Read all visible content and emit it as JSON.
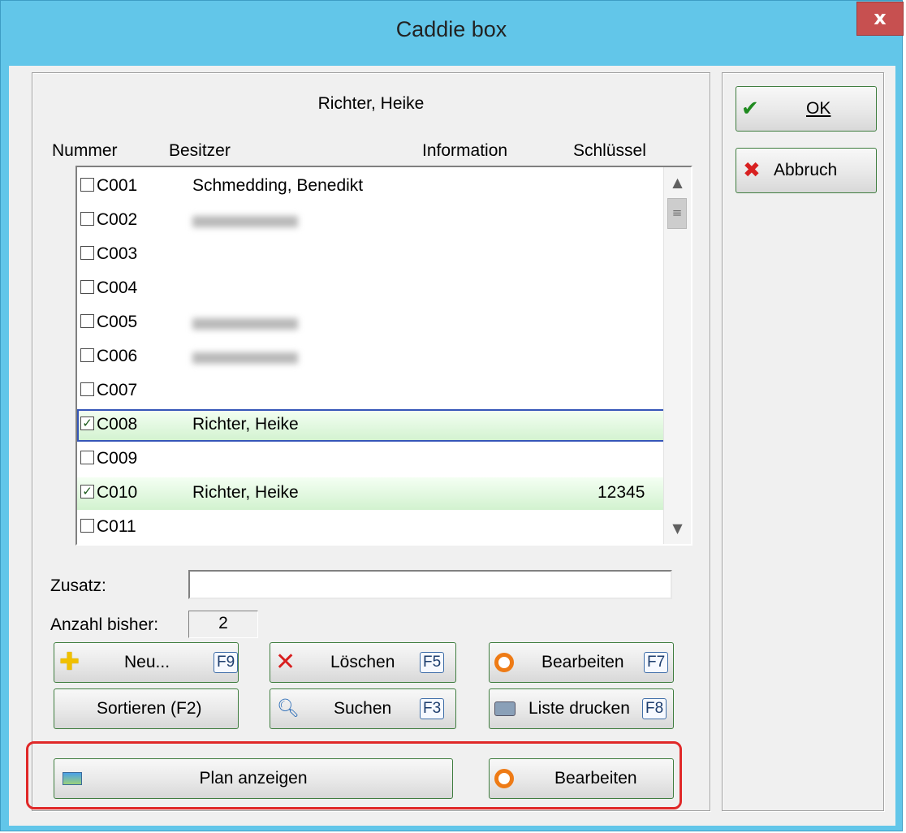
{
  "window": {
    "title": "Caddie box",
    "close_glyph": "x"
  },
  "person_header": "Richter, Heike",
  "columns": {
    "number": "Nummer",
    "owner": "Besitzer",
    "information": "Information",
    "key": "Schlüssel"
  },
  "rows": [
    {
      "checked": false,
      "number": "C001",
      "owner": "Schmedding, Benedikt",
      "owner_blurred": false,
      "info": "",
      "key": ""
    },
    {
      "checked": false,
      "number": "C002",
      "owner": "",
      "owner_blurred": true,
      "info": "",
      "key": ""
    },
    {
      "checked": false,
      "number": "C003",
      "owner": "",
      "owner_blurred": false,
      "info": "",
      "key": ""
    },
    {
      "checked": false,
      "number": "C004",
      "owner": "",
      "owner_blurred": false,
      "info": "",
      "key": ""
    },
    {
      "checked": false,
      "number": "C005",
      "owner": "",
      "owner_blurred": true,
      "info": "",
      "key": ""
    },
    {
      "checked": false,
      "number": "C006",
      "owner": "",
      "owner_blurred": true,
      "info": "",
      "key": ""
    },
    {
      "checked": false,
      "number": "C007",
      "owner": "",
      "owner_blurred": false,
      "info": "",
      "key": ""
    },
    {
      "checked": true,
      "number": "C008",
      "owner": "Richter, Heike",
      "owner_blurred": false,
      "info": "",
      "key": "",
      "selected": true,
      "focused": true
    },
    {
      "checked": false,
      "number": "C009",
      "owner": "",
      "owner_blurred": false,
      "info": "",
      "key": ""
    },
    {
      "checked": true,
      "number": "C010",
      "owner": "Richter, Heike",
      "owner_blurred": false,
      "info": "",
      "key": "12345",
      "selected": true
    },
    {
      "checked": false,
      "number": "C011",
      "owner": "",
      "owner_blurred": false,
      "info": "",
      "key": ""
    }
  ],
  "fields": {
    "zusatz_label": "Zusatz:",
    "zusatz_value": "",
    "count_label": "Anzahl bisher:",
    "count_value": "2"
  },
  "buttons": {
    "new": {
      "label": "Neu...",
      "fkey": "F9"
    },
    "delete": {
      "label": "Löschen",
      "fkey": "F5"
    },
    "edit": {
      "label": "Bearbeiten",
      "fkey": "F7"
    },
    "sort": {
      "label": "Sortieren (F2)"
    },
    "search": {
      "label": "Suchen",
      "fkey": "F3"
    },
    "print": {
      "label": "Liste drucken",
      "fkey": "F8"
    },
    "plan": {
      "label": "Plan anzeigen"
    },
    "edit2": {
      "label": "Bearbeiten"
    },
    "ok": {
      "label": "OK"
    },
    "cancel": {
      "label": "Abbruch"
    }
  },
  "colors": {
    "title_bar": "#62c6e9",
    "selected_row": "#d2f2cf",
    "highlight": "#e02828",
    "button_border": "#3f7d3f"
  }
}
